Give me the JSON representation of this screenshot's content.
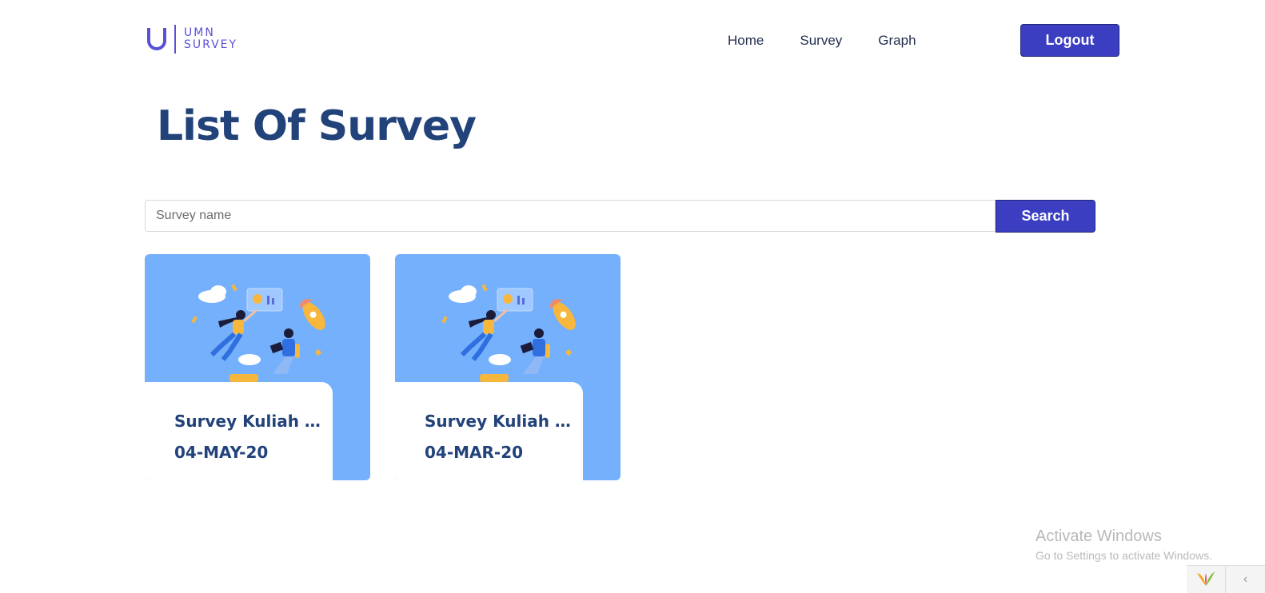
{
  "header": {
    "logo": {
      "letter": "U",
      "line1": "UMN",
      "line2": "SURVEY"
    },
    "nav": [
      {
        "label": "Home"
      },
      {
        "label": "Survey"
      },
      {
        "label": "Graph"
      }
    ],
    "logout_label": "Logout"
  },
  "page": {
    "title": "List Of Survey"
  },
  "search": {
    "placeholder": "Survey name",
    "value": "",
    "button_label": "Search"
  },
  "surveys": [
    {
      "title": "Survey Kuliah A ...",
      "date": "04-MAY-20"
    },
    {
      "title": "Survey Kuliah A ...",
      "date": "04-MAR-20"
    }
  ],
  "windows_watermark": {
    "title": "Activate Windows",
    "subtitle": "Go to Settings to activate Windows."
  },
  "colors": {
    "primary": "#3b3ec0",
    "heading": "#22427a",
    "card_bg": "#74b0fb",
    "logo": "#5a52d6"
  }
}
